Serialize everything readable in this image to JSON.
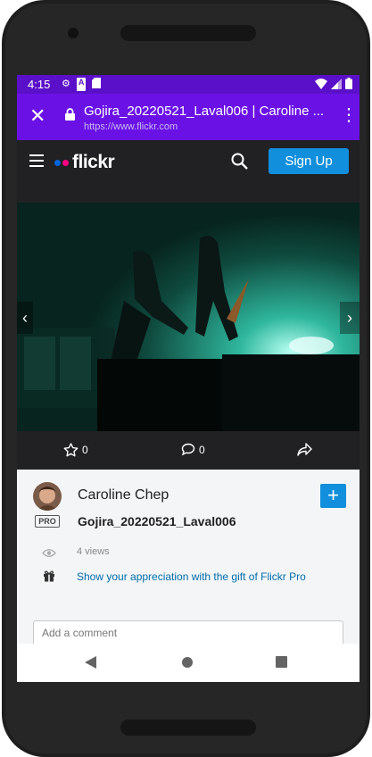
{
  "status_bar": {
    "time": "4:15"
  },
  "browser": {
    "page_title": "Gojira_20220521_Laval006 | Caroline ...",
    "url": "https://www.flickr.com"
  },
  "flickr_header": {
    "logo_text": "flickr",
    "signup_label": "Sign Up",
    "colors": {
      "blue_dot": "#0063dc",
      "pink_dot": "#ff0084",
      "signup_bg": "#128fdc"
    }
  },
  "photo_actions": {
    "faves_count": "0",
    "comments_count": "0"
  },
  "photo_info": {
    "owner_name": "Caroline Chep",
    "pro_badge": "PRO",
    "photo_title": "Gojira_20220521_Laval006",
    "views": "4 views",
    "gift_link": "Show your appreciation with the gift of Flickr Pro",
    "comment_placeholder": "Add a comment"
  }
}
